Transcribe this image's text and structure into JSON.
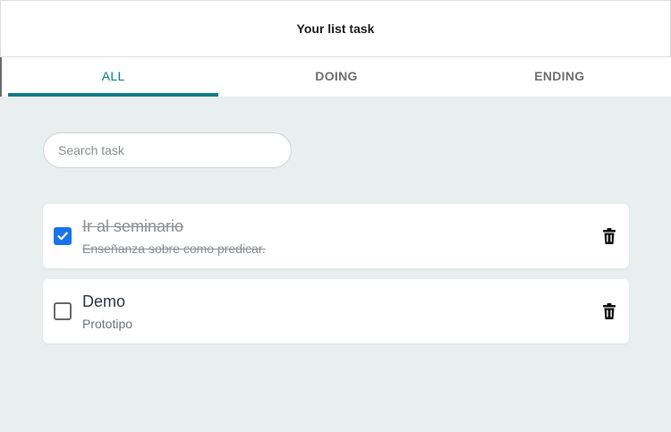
{
  "header": {
    "title": "Your list task"
  },
  "tabs": [
    {
      "label": "ALL",
      "active": true
    },
    {
      "label": "DOING",
      "active": false
    },
    {
      "label": "ENDING",
      "active": false
    }
  ],
  "search": {
    "placeholder": "Search task",
    "value": ""
  },
  "tasks": [
    {
      "title": "Ir al seminario",
      "description": "Enseñanza sobre como predicar.",
      "completed": true,
      "check_icon": "checkmark-icon",
      "delete_icon": "trash-icon"
    },
    {
      "title": "Demo",
      "description": "Prototipo",
      "completed": false,
      "delete_icon": "trash-icon"
    }
  ],
  "colors": {
    "accent": "#0f7d8a",
    "background": "#e9eeee",
    "checkbox_checked": "#1b73e8",
    "card": "#ffffff"
  }
}
